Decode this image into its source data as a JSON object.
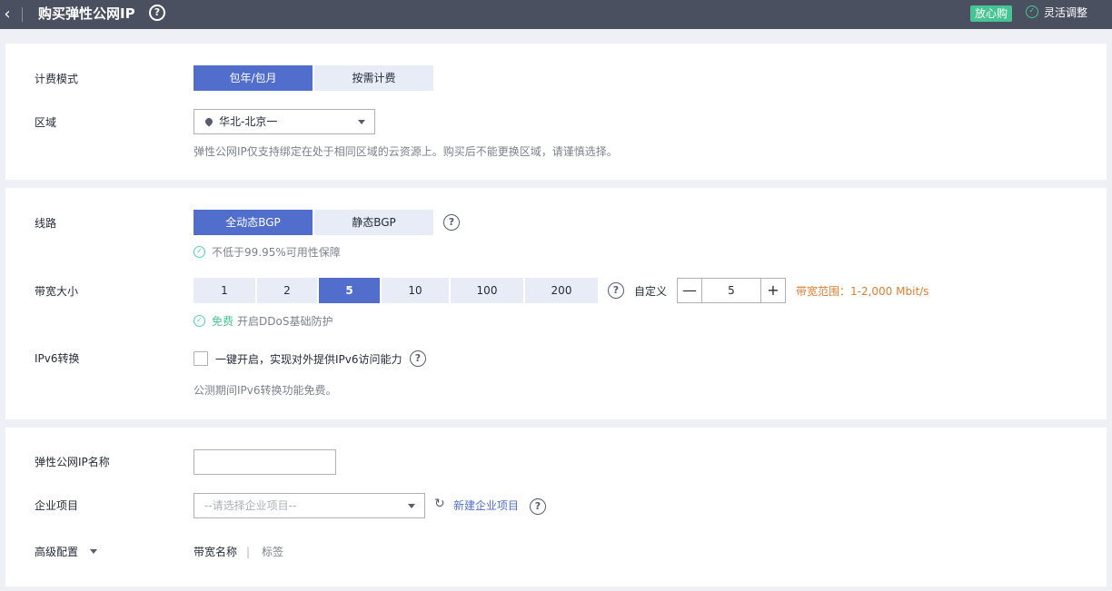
{
  "header": {
    "back_glyph": "‹",
    "title": "购买弹性公网IP",
    "help_glyph": "?",
    "badge": "放心购",
    "flex_adjust": "灵活调整"
  },
  "billing": {
    "label": "计费模式",
    "options": [
      "包年/包月",
      "按需计费"
    ],
    "selected": "包年/包月"
  },
  "region": {
    "label": "区域",
    "value": "华北-北京一",
    "hint": "弹性公网IP仅支持绑定在处于相同区域的云资源上。购买后不能更换区域，请谨慎选择。"
  },
  "line": {
    "label": "线路",
    "options": [
      "全动态BGP",
      "静态BGP"
    ],
    "selected": "全动态BGP",
    "hint": "不低于99.95%可用性保障"
  },
  "bandwidth": {
    "label": "带宽大小",
    "options": [
      "1",
      "2",
      "5",
      "10",
      "100",
      "200"
    ],
    "selected": "5",
    "custom_label": "自定义",
    "stepper_minus": "—",
    "stepper_plus": "+",
    "value": "5",
    "range": "带宽范围：1-2,000 Mbit/s",
    "free_text": "免费",
    "ddos_text": "开启DDoS基础防护"
  },
  "ipv6": {
    "label": "IPv6转换",
    "checkbox_label": "一键开启，实现对外提供IPv6访问能力",
    "checked": false,
    "hint": "公测期间IPv6转换功能免费。"
  },
  "eip_name": {
    "label": "弹性公网IP名称",
    "value": ""
  },
  "enterprise": {
    "label": "企业项目",
    "placeholder": "--请选择企业项目--",
    "refresh_glyph": "↻",
    "new_link": "新建企业项目"
  },
  "advanced": {
    "label": "高级配置",
    "items": [
      "带宽名称",
      "标签"
    ],
    "divider": "|"
  },
  "colors": {
    "accent": "#526ecc",
    "topbar": "#4a5060",
    "success": "#50d4ab",
    "range_text": "#e07d2f"
  }
}
